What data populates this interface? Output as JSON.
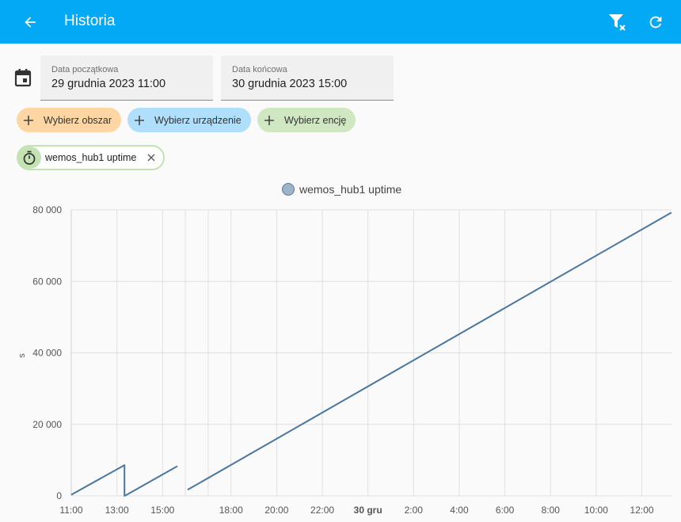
{
  "header": {
    "title": "Historia",
    "back_icon": "arrow-left-icon",
    "clear_filter_icon": "filter-remove-icon",
    "refresh_icon": "refresh-icon",
    "color": "#03a9f4"
  },
  "filters": {
    "calendar_icon": "calendar-icon",
    "start": {
      "label": "Data początkowa",
      "value": "29 grudnia 2023 11:00"
    },
    "end": {
      "label": "Data końcowa",
      "value": "30 grudnia 2023 15:00"
    },
    "targets": [
      {
        "label": "Wybierz obszar",
        "color": "#fdd6a4"
      },
      {
        "label": "Wybierz urządzenie",
        "color": "#b0dffb"
      },
      {
        "label": "Wybierz encję",
        "color": "#cfe8c1"
      }
    ],
    "selected_entity": {
      "label": "wemos_hub1 uptime",
      "icon": "timer-icon",
      "color": "#c5e2b5"
    }
  },
  "chart_data": {
    "type": "line",
    "legend": [
      "wemos_hub1 uptime"
    ],
    "legend_position": "top-center",
    "ylabel": "s",
    "ylim": [
      0,
      80000
    ],
    "yticks": [
      {
        "v": 0,
        "label": "0"
      },
      {
        "v": 20000,
        "label": "20 000"
      },
      {
        "v": 40000,
        "label": "40 000"
      },
      {
        "v": 60000,
        "label": "60 000"
      },
      {
        "v": 80000,
        "label": "80 000"
      }
    ],
    "x_unit": "hours since 29 Dec 2023 00:00",
    "xlim": [
      11,
      37.3
    ],
    "xticks": [
      {
        "v": 11,
        "label": "11:00",
        "bold": false
      },
      {
        "v": 13,
        "label": "13:00",
        "bold": false
      },
      {
        "v": 15,
        "label": "15:00",
        "bold": false
      },
      {
        "v": 18,
        "label": "18:00",
        "bold": false
      },
      {
        "v": 20,
        "label": "20:00",
        "bold": false
      },
      {
        "v": 22,
        "label": "22:00",
        "bold": false
      },
      {
        "v": 24,
        "label": "30 gru",
        "bold": true
      },
      {
        "v": 26,
        "label": "2:00",
        "bold": false
      },
      {
        "v": 28,
        "label": "4:00",
        "bold": false
      },
      {
        "v": 30,
        "label": "6:00",
        "bold": false
      },
      {
        "v": 32,
        "label": "8:00",
        "bold": false
      },
      {
        "v": 34,
        "label": "10:00",
        "bold": false
      },
      {
        "v": 36,
        "label": "12:00",
        "bold": false
      }
    ],
    "grid_extra_x": [
      16,
      17
    ],
    "grid": true,
    "series": [
      {
        "name": "wemos_hub1 uptime",
        "color": "#4a76a0",
        "segments": [
          [
            [
              11.0,
              300
            ],
            [
              13.33,
              8600
            ],
            [
              13.33,
              0
            ],
            [
              13.43,
              300
            ],
            [
              15.65,
              8300
            ]
          ],
          [
            [
              16.1,
              1700
            ],
            [
              37.3,
              79300
            ]
          ]
        ]
      }
    ]
  }
}
